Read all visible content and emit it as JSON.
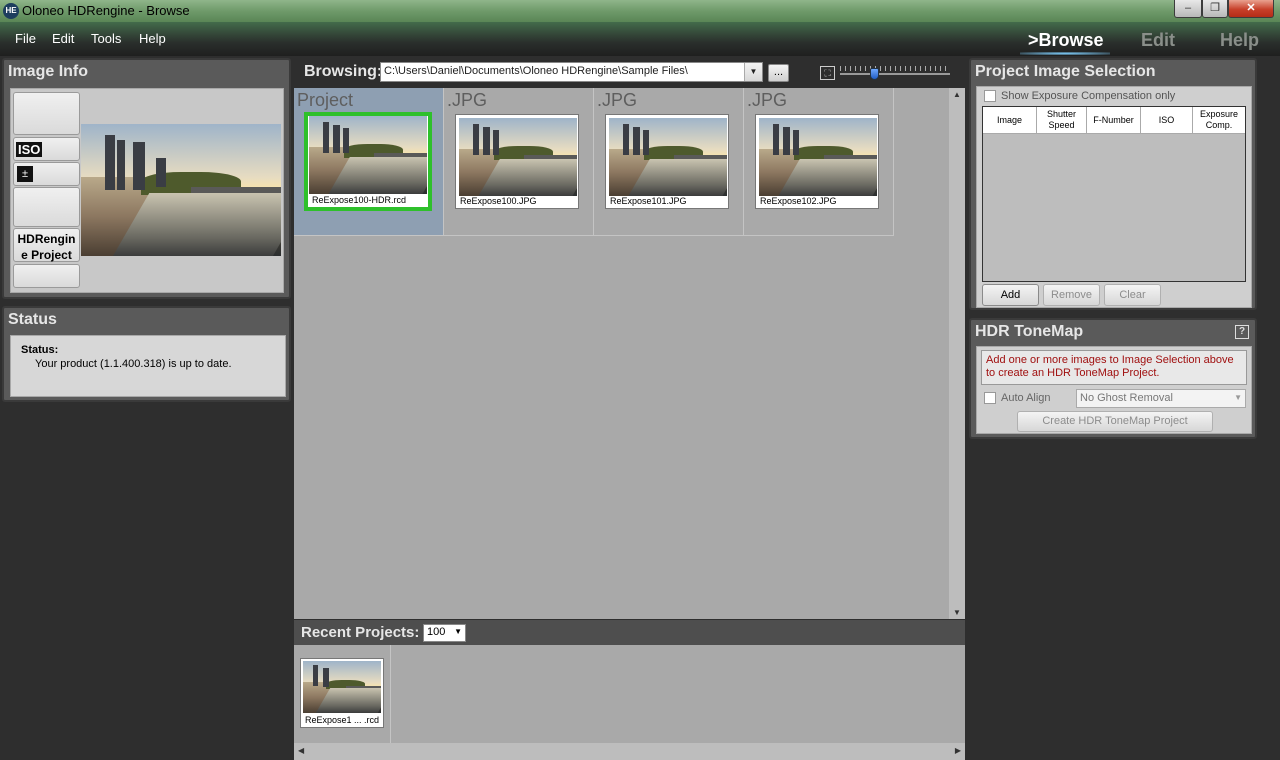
{
  "window": {
    "title": "Oloneo HDRengine - Browse",
    "app_icon": "HE",
    "min_glyph": "–",
    "max_glyph": "❐",
    "close_glyph": "✕"
  },
  "menu": {
    "items": [
      "File",
      "Edit",
      "Tools",
      "Help"
    ],
    "modes": {
      "browse": ">Browse",
      "edit": "Edit",
      "help": "Help"
    }
  },
  "image_info": {
    "title": "Image Info",
    "iso_label": "ISO",
    "exposure_icon": "exposure-icon",
    "project_label": "HDRengin e Project"
  },
  "status_panel": {
    "title": "Status",
    "label": "Status:",
    "message": "Your product (1.1.400.318) is up to date."
  },
  "browse": {
    "label": "Browsing:",
    "path": "C:\\Users\\Daniel\\Documents\\Oloneo HDRengine\\Sample Files\\",
    "browse_button": "...",
    "fit_icon": "fit-to-window-icon",
    "zoom_level": 0.27,
    "items": [
      {
        "type": "Project",
        "name": "ReExpose100-HDR.rcd",
        "selected": true
      },
      {
        "type": ".JPG",
        "name": "ReExpose100.JPG",
        "selected": false
      },
      {
        "type": ".JPG",
        "name": "ReExpose101.JPG",
        "selected": false
      },
      {
        "type": ".JPG",
        "name": "ReExpose102.JPG",
        "selected": false
      }
    ]
  },
  "recent": {
    "label": "Recent Projects:",
    "count": "100",
    "items": [
      {
        "name": "ReExpose1 ... .rcd"
      }
    ]
  },
  "project_selection": {
    "title": "Project Image Selection",
    "checkbox_label": "Show Exposure Compensation only",
    "columns": [
      "Image",
      "Shutter Speed",
      "F-Number",
      "ISO",
      "Exposure Comp."
    ],
    "buttons": {
      "add": "Add",
      "remove": "Remove",
      "clear": "Clear"
    }
  },
  "hdr_tonemap": {
    "title": "HDR ToneMap",
    "help_glyph": "?",
    "message": "Add one or more images to Image Selection above to create an HDR ToneMap Project.",
    "auto_align_label": "Auto Align",
    "ghost_option": "No Ghost Removal",
    "create_button": "Create HDR ToneMap Project"
  },
  "colors": {
    "selection_border": "#2ec02b",
    "message_text": "#a01010"
  }
}
